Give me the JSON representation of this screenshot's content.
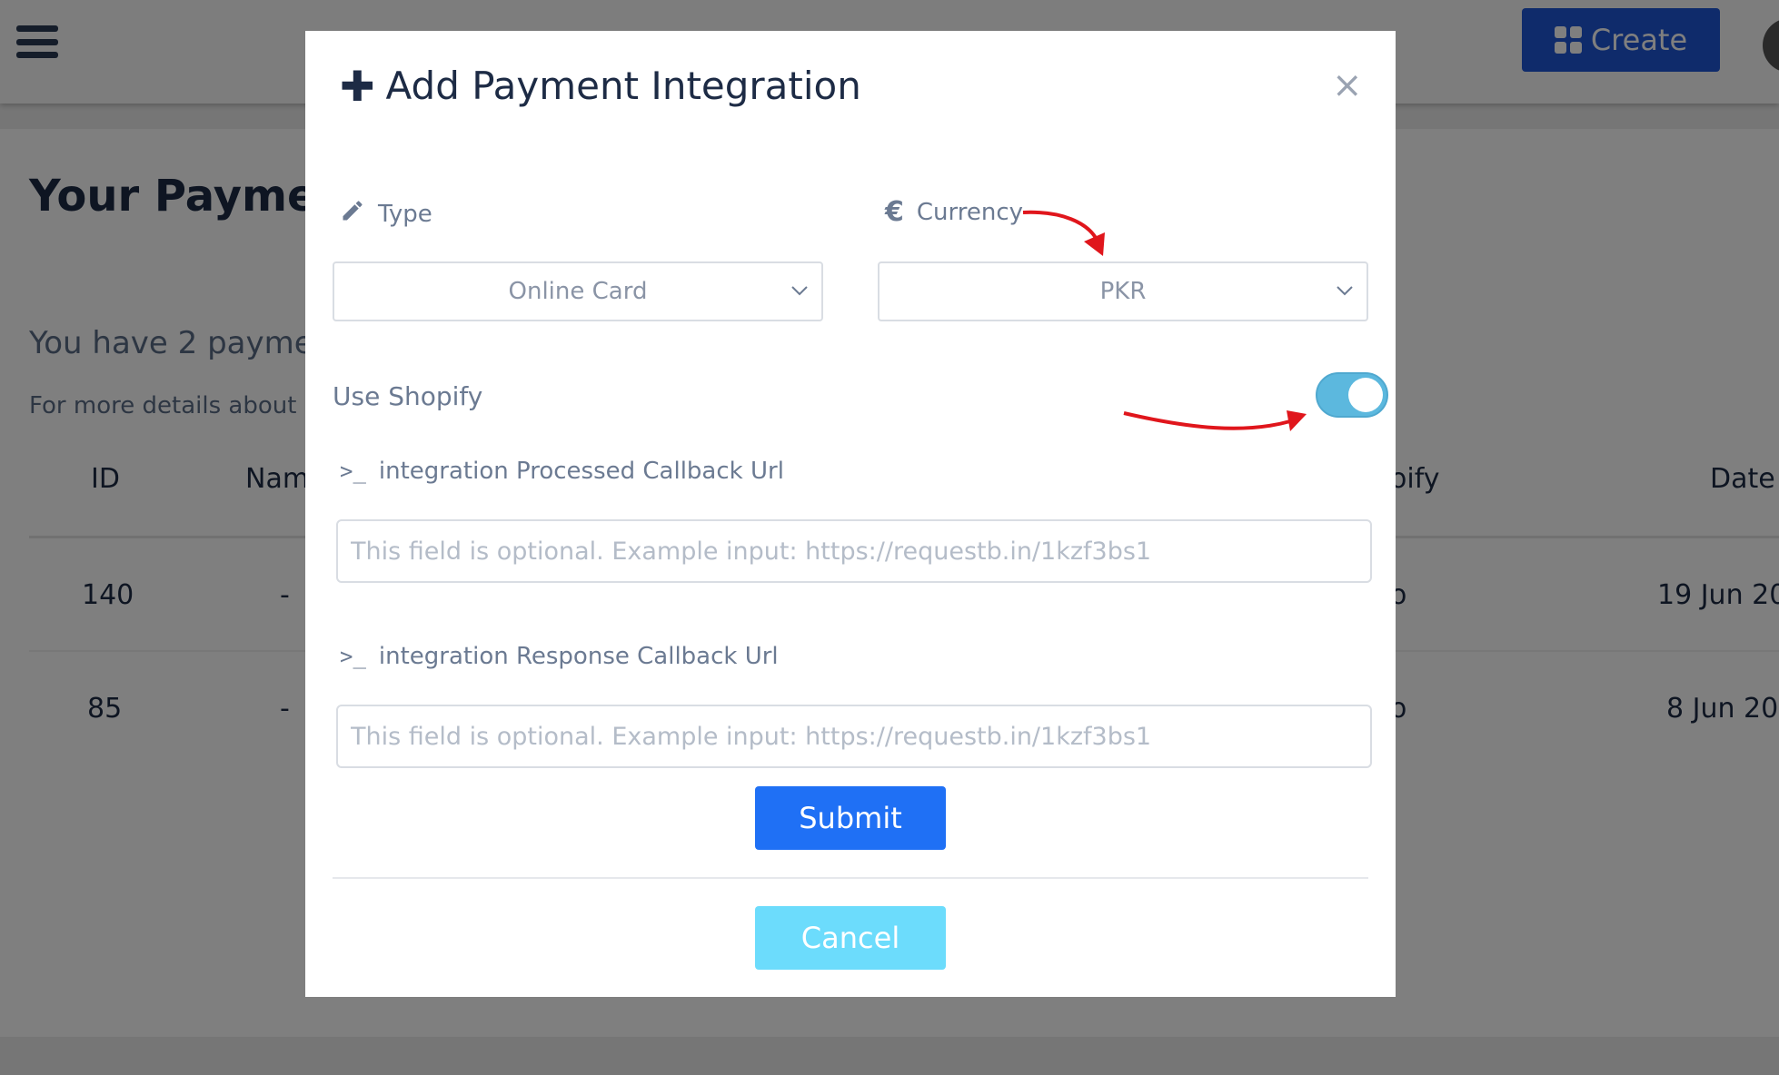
{
  "app": {
    "create_button": "Create",
    "page_heading": "Your Paymen",
    "summary_text": "You have 2 payme",
    "details_text": "For more details about"
  },
  "table": {
    "headers": [
      "ID",
      "Nam",
      "oify",
      "Date"
    ],
    "rows": [
      {
        "id": "140",
        "name": "-",
        "shopify": "o",
        "date": "19 Jun 20"
      },
      {
        "id": "85",
        "name": "-",
        "shopify": "o",
        "date": "8 Jun 20"
      }
    ]
  },
  "modal": {
    "title": "Add Payment Integration",
    "close_symbol": "×",
    "type_label": "Type",
    "type_value": "Online Card",
    "currency_label": "Currency",
    "currency_symbol": "€",
    "currency_value": "PKR",
    "use_shopify_label": "Use Shopify",
    "use_shopify_on": true,
    "processed_callback_label": "integration Processed Callback Url",
    "processed_callback_placeholder": "This field is optional. Example input: https://requestb.in/1kzf3bs1",
    "response_callback_label": "integration Response Callback Url",
    "response_callback_placeholder": "This field is optional. Example input: https://requestb.in/1kzf3bs1",
    "prompt_symbol": ">_",
    "submit_label": "Submit",
    "cancel_label": "Cancel"
  },
  "colors": {
    "primary": "#1f70f5",
    "cancel": "#6cdcfc",
    "toggle_on": "#5cb8de",
    "annotation_arrow": "#e0161c",
    "create_button": "#1f56d6"
  },
  "icons": {
    "menu": "hamburger-icon",
    "create": "grid-icon",
    "title": "plus-icon",
    "type": "pencil-icon",
    "currency": "euro-icon",
    "callback": "terminal-prompt-icon",
    "close": "close-icon",
    "select": "chevron-down-icon"
  }
}
